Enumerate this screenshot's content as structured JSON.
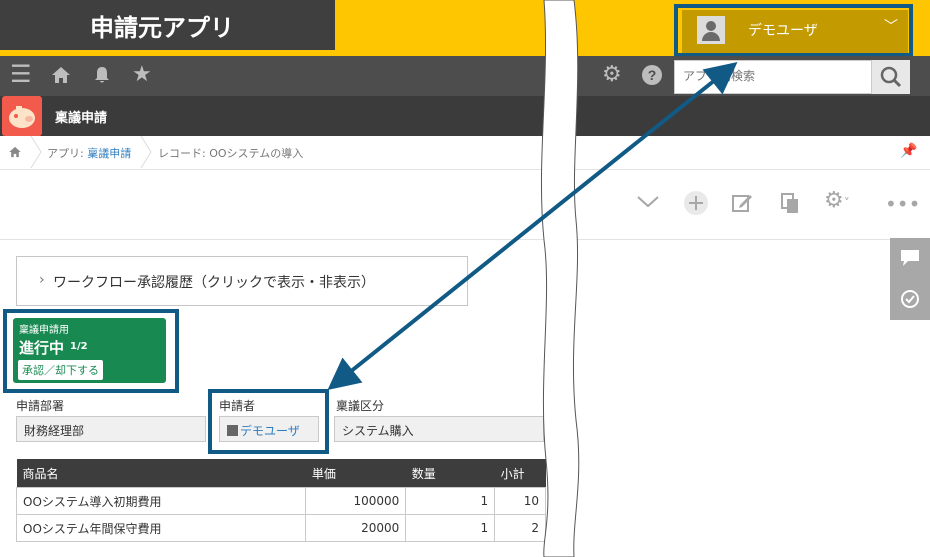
{
  "banner": {
    "title": "申請元アプリ"
  },
  "user": {
    "name": "デモユーザ"
  },
  "search": {
    "placeholder": "アプリ内検索"
  },
  "app": {
    "name": "稟議申請"
  },
  "breadcrumb": {
    "app_prefix": "アプリ: ",
    "app_link": "稟議申請",
    "record": "レコード: OOシステムの導入"
  },
  "workflow": {
    "toggle_label": "ワークフロー承認履歴（クリックで表示・非表示）"
  },
  "status": {
    "process_name": "稟議申請用",
    "state": "進行中",
    "step": "1/2",
    "action": "承認／却下する"
  },
  "fields": {
    "department_label": "申請部署",
    "department_value": "財務経理部",
    "applicant_label": "申請者",
    "applicant_value": "デモユーザ",
    "category_label": "稟議区分",
    "category_value": "システム購入"
  },
  "table": {
    "headers": [
      "商品名",
      "単価",
      "数量",
      "小計"
    ],
    "rows": [
      [
        "OOシステム導入初期費用",
        "100000",
        "1",
        "10"
      ],
      [
        "OOシステム年間保守費用",
        "20000",
        "1",
        "2"
      ]
    ]
  },
  "icons": {
    "menu": "hamburger-icon",
    "home": "home-icon",
    "bell": "bell-icon",
    "star": "star-icon",
    "gear": "gear-icon",
    "help": "help-icon",
    "search": "search-icon"
  },
  "colors": {
    "accent_yellow": "#fec600",
    "highlight_blue": "#115a86",
    "status_green": "#188a51",
    "app_icon": "#f25a4c"
  }
}
